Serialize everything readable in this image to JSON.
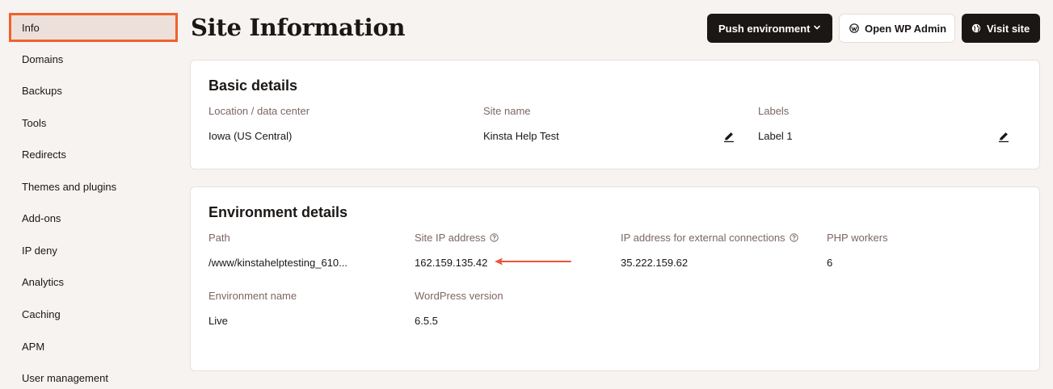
{
  "sidebar": {
    "active": "Info",
    "items": [
      {
        "label": "Domains"
      },
      {
        "label": "Backups"
      },
      {
        "label": "Tools"
      },
      {
        "label": "Redirects"
      },
      {
        "label": "Themes and plugins"
      },
      {
        "label": "Add-ons"
      },
      {
        "label": "IP deny"
      },
      {
        "label": "Analytics"
      },
      {
        "label": "Caching"
      },
      {
        "label": "APM"
      },
      {
        "label": "User management"
      }
    ]
  },
  "header": {
    "title": "Site Information",
    "push_label": "Push environment",
    "wp_admin_label": "Open WP Admin",
    "visit_label": "Visit site"
  },
  "basic": {
    "title": "Basic details",
    "location_label": "Location / data center",
    "location_value": "Iowa (US Central)",
    "site_name_label": "Site name",
    "site_name_value": "Kinsta Help Test",
    "labels_label": "Labels",
    "labels_value": "Label 1"
  },
  "env": {
    "title": "Environment details",
    "path_label": "Path",
    "path_value": "/www/kinstahelptesting_610...",
    "ip_label": "Site IP address",
    "ip_value": "162.159.135.42",
    "ext_ip_label": "IP address for external connections",
    "ext_ip_value": "35.222.159.62",
    "php_label": "PHP workers",
    "php_value": "6",
    "env_name_label": "Environment name",
    "env_name_value": "Live",
    "wp_version_label": "WordPress version",
    "wp_version_value": "6.5.5"
  },
  "colors": {
    "accent": "#f0612c",
    "arrow": "#e8553a",
    "dark_button": "#1b1715",
    "background": "#f7f3f1"
  }
}
